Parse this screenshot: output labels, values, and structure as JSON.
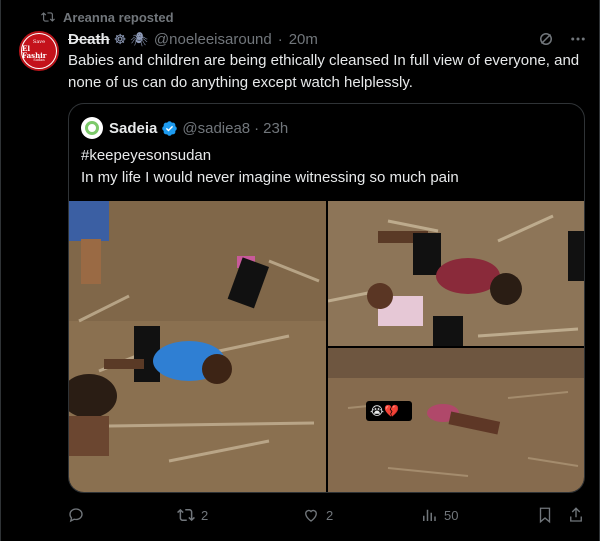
{
  "repost": {
    "label": "Areanna reposted",
    "icon": "repost-icon"
  },
  "author": {
    "name": "Death",
    "emoji": "☸ 🕷",
    "handle": "@noeleeisaround",
    "sep": "·",
    "time": "20m",
    "avatar_text": [
      "Save",
      "El Fashir",
      "Sudan"
    ]
  },
  "tweet": {
    "text": "Babies and children are being ethically cleansed In full view of everyone, and none of us can do anything except watch helplessly."
  },
  "quote": {
    "name": "Sadeia",
    "handle": "@sadiea8",
    "sep": "·",
    "time": "23h",
    "line1": "#keepeyesonsudan",
    "line2": "In my life I would never imagine witnessing so much pain",
    "overlay_emoji": "😭💔"
  },
  "stats": {
    "reply": "",
    "reposts": "2",
    "likes": "2",
    "views": "50"
  },
  "colors": {
    "background": "#000000",
    "text": "#e7e9ea",
    "muted": "#71767b",
    "border": "#2f3336",
    "verified": "#1d9bf0"
  }
}
